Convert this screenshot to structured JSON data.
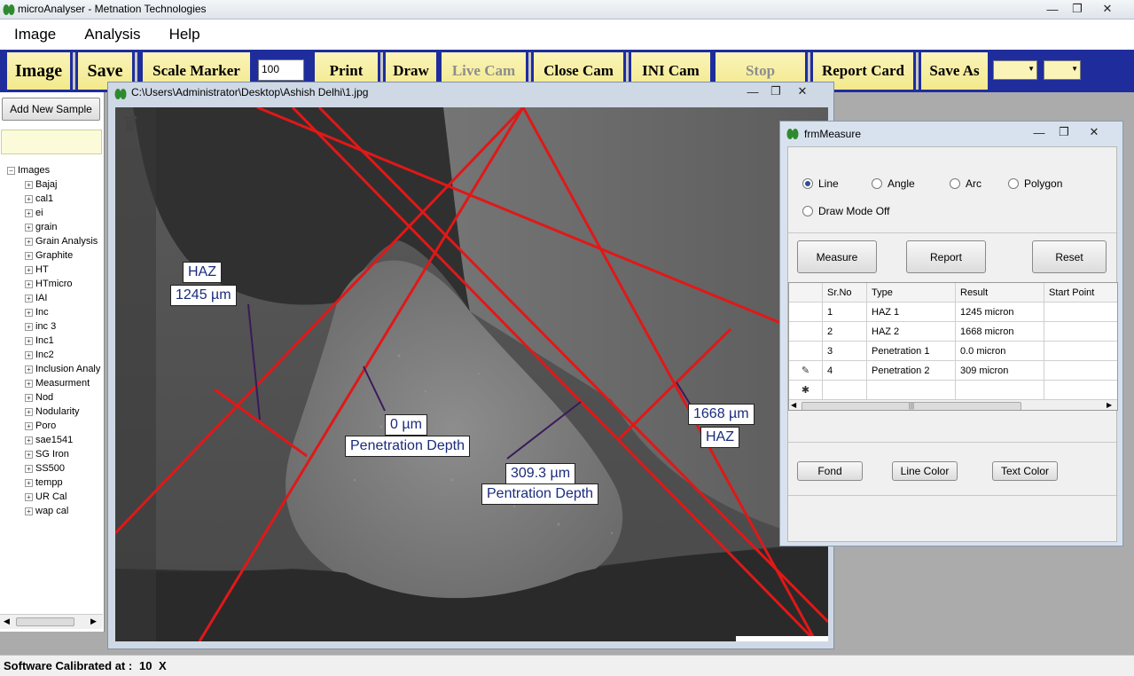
{
  "app": {
    "title": "microAnalyser - Metnation Technologies"
  },
  "menu": [
    "Image",
    "Analysis",
    "Help"
  ],
  "toolbar": {
    "image": "Image",
    "save": "Save",
    "scale_marker": "Scale Marker",
    "scale_value": "100",
    "print": "Print",
    "draw": "Draw",
    "live_cam": "Live Cam",
    "close_cam": "Close Cam",
    "ini_cam": "INI Cam",
    "stop": "Stop",
    "report_card": "Report Card",
    "save_as": "Save As"
  },
  "left_panel": {
    "add_sample": "Add New Sample",
    "tree_root": "Images",
    "tree_items": [
      "Bajaj",
      "cal1",
      "ei",
      "grain",
      "Grain Analysis",
      "Graphite",
      "HT",
      "HTmicro",
      "IAI",
      "Inc",
      "inc 3",
      "Inc1",
      "Inc2",
      "Inclusion Analy",
      "Measurment",
      "Nod",
      "Nodularity",
      "Poro",
      "sae1541",
      "SG Iron",
      "SS500",
      "tempp",
      "UR Cal",
      "wap cal"
    ]
  },
  "image_window": {
    "path": "C:\\Users\\Administrator\\Desktop\\Ashish Delhi\\1.jpg",
    "annotations": {
      "haz_left_label": "HAZ",
      "haz_left_value": "1245 µm",
      "pen1_value": "0 µm",
      "pen1_label": "Penetration Depth",
      "pen2_value": "309.3 µm",
      "pen2_label": "Pentration Depth",
      "haz_right_value": "1668 µm",
      "haz_right_label": "HAZ"
    }
  },
  "measure_window": {
    "title": "frmMeasure",
    "modes": [
      {
        "label": "Line",
        "selected": true
      },
      {
        "label": "Angle",
        "selected": false
      },
      {
        "label": "Arc",
        "selected": false
      },
      {
        "label": "Polygon",
        "selected": false
      },
      {
        "label": "Draw Mode Off",
        "selected": false
      }
    ],
    "buttons": {
      "measure": "Measure",
      "report": "Report",
      "reset": "Reset",
      "fond": "Fond",
      "line_color": "Line Color",
      "text_color": "Text Color"
    },
    "columns": [
      "Sr.No",
      "Type",
      "Result",
      "Start Point"
    ],
    "rows": [
      {
        "sr": "1",
        "type": "HAZ 1",
        "result": "1245 micron",
        "start": ""
      },
      {
        "sr": "2",
        "type": "HAZ 2",
        "result": "1668 micron",
        "start": ""
      },
      {
        "sr": "3",
        "type": "Penetration 1",
        "result": "0.0 micron",
        "start": ""
      },
      {
        "sr": "4",
        "type": "Penetration 2",
        "result": "309 micron",
        "start": ""
      }
    ]
  },
  "status": {
    "label": "Software Calibrated at :",
    "value": "10",
    "unit": "X"
  },
  "colors": {
    "toolbar_bg": "#1f2d9c",
    "button_face": "#fbf4b8",
    "measure_line": "#e01818",
    "annotation_text": "#1a2c7c"
  }
}
